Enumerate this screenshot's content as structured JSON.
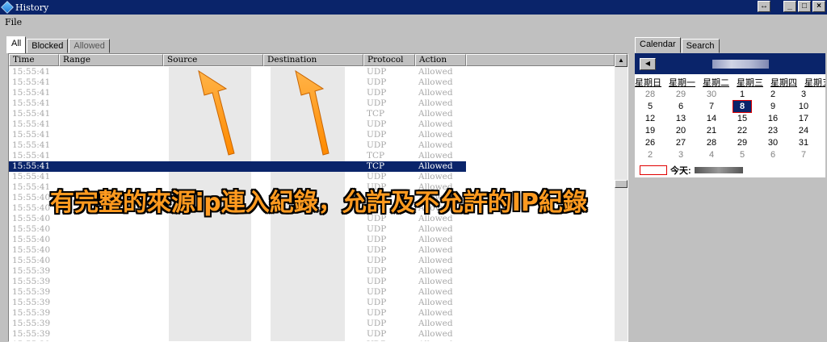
{
  "window": {
    "title": "History"
  },
  "title_buttons": {
    "resize": "↔",
    "minimize": "_",
    "maximize": "□",
    "close": "×"
  },
  "menu": {
    "file": "File"
  },
  "tabs": [
    {
      "label": "All",
      "active": true
    },
    {
      "label": "Blocked",
      "active": false
    },
    {
      "label": "Allowed",
      "active": false
    }
  ],
  "columns": {
    "time": "Time",
    "range": "Range",
    "source": "Source",
    "destination": "Destination",
    "protocol": "Protocol",
    "action": "Action"
  },
  "rows": [
    {
      "time": "15:55:41",
      "protocol": "UDP",
      "action": "Allowed",
      "selected": false
    },
    {
      "time": "15:55:41",
      "protocol": "UDP",
      "action": "Allowed",
      "selected": false
    },
    {
      "time": "15:55:41",
      "protocol": "UDP",
      "action": "Allowed",
      "selected": false
    },
    {
      "time": "15:55:41",
      "protocol": "UDP",
      "action": "Allowed",
      "selected": false
    },
    {
      "time": "15:55:41",
      "protocol": "TCP",
      "action": "Allowed",
      "selected": false
    },
    {
      "time": "15:55:41",
      "protocol": "UDP",
      "action": "Allowed",
      "selected": false
    },
    {
      "time": "15:55:41",
      "protocol": "UDP",
      "action": "Allowed",
      "selected": false
    },
    {
      "time": "15:55:41",
      "protocol": "UDP",
      "action": "Allowed",
      "selected": false
    },
    {
      "time": "15:55:41",
      "protocol": "TCP",
      "action": "Allowed",
      "selected": false
    },
    {
      "time": "15:55:41",
      "protocol": "TCP",
      "action": "Allowed",
      "selected": true
    },
    {
      "time": "15:55:41",
      "protocol": "UDP",
      "action": "Allowed",
      "selected": false
    },
    {
      "time": "15:55:41",
      "protocol": "UDP",
      "action": "Allowed",
      "selected": false
    },
    {
      "time": "15:55:40",
      "protocol": "UDP",
      "action": "Allowed",
      "selected": false
    },
    {
      "time": "15:55:40",
      "protocol": "UDP",
      "action": "Allowed",
      "selected": false
    },
    {
      "time": "15:55:40",
      "protocol": "UDP",
      "action": "Allowed",
      "selected": false
    },
    {
      "time": "15:55:40",
      "protocol": "UDP",
      "action": "Allowed",
      "selected": false
    },
    {
      "time": "15:55:40",
      "protocol": "UDP",
      "action": "Allowed",
      "selected": false
    },
    {
      "time": "15:55:40",
      "protocol": "UDP",
      "action": "Allowed",
      "selected": false
    },
    {
      "time": "15:55:40",
      "protocol": "UDP",
      "action": "Allowed",
      "selected": false
    },
    {
      "time": "15:55:39",
      "protocol": "UDP",
      "action": "Allowed",
      "selected": false
    },
    {
      "time": "15:55:39",
      "protocol": "UDP",
      "action": "Allowed",
      "selected": false
    },
    {
      "time": "15:55:39",
      "protocol": "UDP",
      "action": "Allowed",
      "selected": false
    },
    {
      "time": "15:55:39",
      "protocol": "UDP",
      "action": "Allowed",
      "selected": false
    },
    {
      "time": "15:55:39",
      "protocol": "UDP",
      "action": "Allowed",
      "selected": false
    },
    {
      "time": "15:55:39",
      "protocol": "UDP",
      "action": "Allowed",
      "selected": false
    },
    {
      "time": "15:55:39",
      "protocol": "UDP",
      "action": "Allowed",
      "selected": false
    },
    {
      "time": "15:55:39",
      "protocol": "UDP",
      "action": "Allowed",
      "selected": false
    }
  ],
  "caption": "有完整的來源ip連入紀錄，允許及不允許的IP紀錄",
  "right_tabs": [
    {
      "label": "Calendar",
      "active": true
    },
    {
      "label": "Search",
      "active": false
    }
  ],
  "calendar": {
    "weekdays": [
      "星期日",
      "星期一",
      "星期二",
      "星期三",
      "星期四",
      "星期五"
    ],
    "weeks": [
      [
        {
          "d": "28",
          "dim": true
        },
        {
          "d": "29",
          "dim": true
        },
        {
          "d": "30",
          "dim": true
        },
        {
          "d": "1"
        },
        {
          "d": "2"
        },
        {
          "d": "3"
        }
      ],
      [
        {
          "d": "5"
        },
        {
          "d": "6"
        },
        {
          "d": "7"
        },
        {
          "d": "8",
          "today": true
        },
        {
          "d": "9"
        },
        {
          "d": "10"
        }
      ],
      [
        {
          "d": "12"
        },
        {
          "d": "13"
        },
        {
          "d": "14"
        },
        {
          "d": "15"
        },
        {
          "d": "16"
        },
        {
          "d": "17"
        }
      ],
      [
        {
          "d": "19"
        },
        {
          "d": "20"
        },
        {
          "d": "21"
        },
        {
          "d": "22"
        },
        {
          "d": "23"
        },
        {
          "d": "24"
        }
      ],
      [
        {
          "d": "26"
        },
        {
          "d": "27"
        },
        {
          "d": "28"
        },
        {
          "d": "29"
        },
        {
          "d": "30"
        },
        {
          "d": "31"
        }
      ],
      [
        {
          "d": "2",
          "dim": true
        },
        {
          "d": "3",
          "dim": true
        },
        {
          "d": "4",
          "dim": true
        },
        {
          "d": "5",
          "dim": true
        },
        {
          "d": "6",
          "dim": true
        },
        {
          "d": "7",
          "dim": true
        }
      ]
    ],
    "today_label": "今天:"
  },
  "colors": {
    "titlebar": "#0a246a",
    "selection": "#0a246a",
    "annotation": "#ff9a1f",
    "today_outline": "#e00000"
  }
}
